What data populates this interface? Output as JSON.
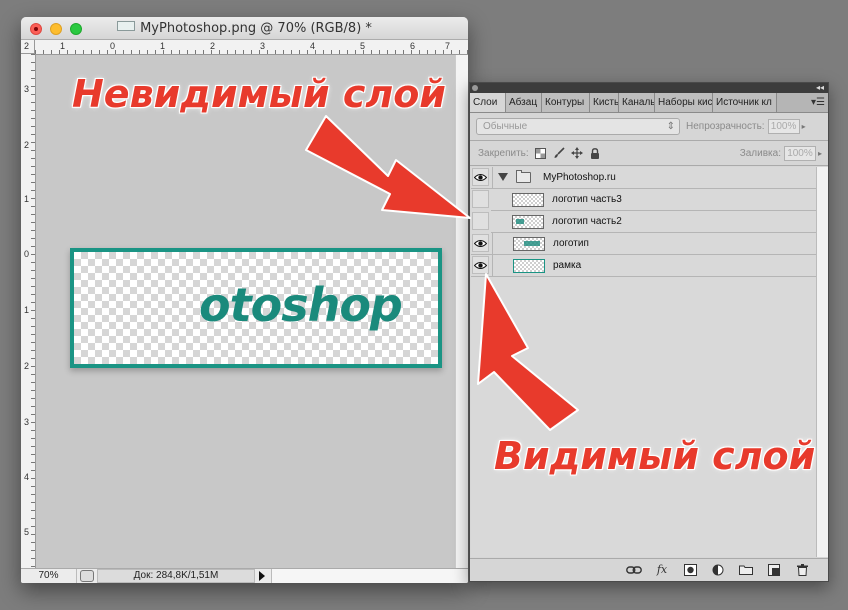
{
  "document": {
    "title": "MyPhotoshop.png @ 70% (RGB/8) *",
    "ruler_top_numbers": [
      "2",
      "1",
      "0",
      "1",
      "2",
      "3",
      "4",
      "5",
      "6",
      "7"
    ],
    "ruler_left_numbers": [
      "3",
      "2",
      "1",
      "0",
      "1",
      "2",
      "3",
      "4",
      "5"
    ],
    "artwork_text": "otoshop",
    "status": {
      "zoom": "70%",
      "doc_info": "Док: 284,8K/1,51M"
    }
  },
  "panel": {
    "tabs": [
      "Слои",
      "Абзац",
      "Контуры",
      "Кисть",
      "Каналы",
      "Наборы кис",
      "Источник кл"
    ],
    "blend_mode": "Обычные",
    "opacity_label": "Непрозрачность:",
    "opacity_value": "100%",
    "lock_label": "Закрепить:",
    "fill_label": "Заливка:",
    "fill_value": "100%",
    "layers": [
      {
        "name": "MyPhotoshop.ru",
        "visible": true,
        "group": true
      },
      {
        "name": "логотип часть3",
        "visible": false,
        "group": false
      },
      {
        "name": "логотип часть2",
        "visible": false,
        "group": false
      },
      {
        "name": "логотип",
        "visible": true,
        "group": false
      },
      {
        "name": "рамка",
        "visible": true,
        "group": false
      }
    ]
  },
  "annotations": {
    "invisible_layer": "Невидимый слой",
    "visible_layer": "Видимый слой",
    "color": "#e83a2c"
  },
  "colors": {
    "artwork_teal": "#1a9484",
    "canvas_gray": "#c8c8c8",
    "panel_bg": "#d6d6d6"
  }
}
